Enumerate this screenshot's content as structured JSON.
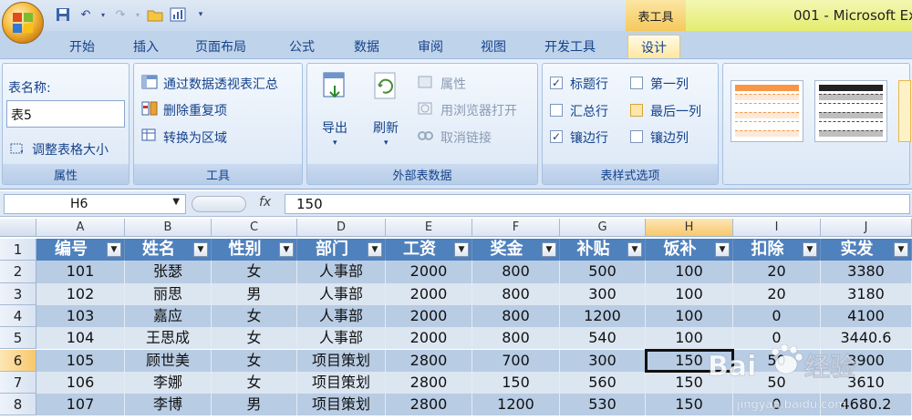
{
  "title": {
    "contextual_tab": "表工具",
    "window_title": "001 - Microsoft Ex"
  },
  "tabs": [
    "开始",
    "插入",
    "页面布局",
    "公式",
    "数据",
    "审阅",
    "视图",
    "开发工具",
    "设计"
  ],
  "ribbon": {
    "properties": {
      "table_name_label": "表名称:",
      "table_name_value": "表5",
      "resize_label": "调整表格大小",
      "group_label": "属性"
    },
    "tools": {
      "pivot": "通过数据透视表汇总",
      "remove_dupes": "删除重复项",
      "convert": "转换为区域",
      "group_label": "工具"
    },
    "external": {
      "export": "导出",
      "refresh": "刷新",
      "properties": "属性",
      "open_browser": "用浏览器打开",
      "unlink": "取消链接",
      "group_label": "外部表数据"
    },
    "style_options": {
      "header_row": "标题行",
      "total_row": "汇总行",
      "banded_rows": "镶边行",
      "first_column": "第一列",
      "last_column": "最后一列",
      "banded_columns": "镶边列",
      "group_label": "表样式选项"
    }
  },
  "formula_bar": {
    "name_box": "H6",
    "fx": "fx",
    "content": "150"
  },
  "sheet": {
    "columns": [
      "A",
      "B",
      "C",
      "D",
      "E",
      "F",
      "G",
      "H",
      "I",
      "J"
    ],
    "rows": [
      "1",
      "2",
      "3",
      "4",
      "5",
      "6",
      "7",
      "8"
    ],
    "header": [
      "编号",
      "姓名",
      "性别",
      "部门",
      "工资",
      "奖金",
      "补贴",
      "饭补",
      "扣除",
      "实发"
    ],
    "data": [
      [
        "101",
        "张瑟",
        "女",
        "人事部",
        "2000",
        "800",
        "500",
        "100",
        "20",
        "3380"
      ],
      [
        "102",
        "丽思",
        "男",
        "人事部",
        "2000",
        "800",
        "300",
        "100",
        "20",
        "3180"
      ],
      [
        "103",
        "嘉应",
        "女",
        "人事部",
        "2000",
        "800",
        "1200",
        "100",
        "0",
        "4100"
      ],
      [
        "104",
        "王思成",
        "女",
        "人事部",
        "2000",
        "800",
        "540",
        "100",
        "0",
        "3440.6"
      ],
      [
        "105",
        "顾世美",
        "女",
        "项目策划",
        "2800",
        "700",
        "300",
        "150",
        "50",
        "3900"
      ],
      [
        "106",
        "李娜",
        "女",
        "项目策划",
        "2800",
        "150",
        "560",
        "150",
        "50",
        "3610"
      ],
      [
        "107",
        "李博",
        "男",
        "项目策划",
        "2800",
        "1200",
        "530",
        "150",
        "0",
        "4680.2"
      ]
    ]
  },
  "watermark": {
    "brand": "Bai",
    "suffix": "经验",
    "url": "jingyan.baidu.com"
  },
  "colors": {
    "header_fill": "#4f81bd",
    "band_light": "#dce6f1",
    "band_mid": "#b8cce4"
  }
}
